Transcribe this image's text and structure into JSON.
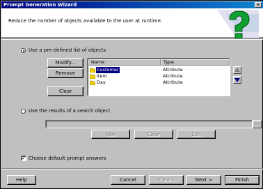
{
  "window": {
    "title": "Prompt Generation Wizard",
    "close_glyph": "×"
  },
  "header": {
    "description": "Reduce the number of objects available to the user at runtime."
  },
  "options": {
    "predefined_label": "Use a pre-defined list of objects",
    "predefined_selected": true,
    "search_label": "Use the results of a search object",
    "search_selected": false
  },
  "list_buttons": {
    "modify": "Modify...",
    "remove": "Remove",
    "clear": "Clear"
  },
  "list": {
    "columns": [
      "Name",
      "Type"
    ],
    "rows": [
      {
        "name": "Customer",
        "type": "Attribute",
        "selected": true
      },
      {
        "name": "Item",
        "type": "Attribute",
        "selected": false
      },
      {
        "name": "Day",
        "type": "Attribute",
        "selected": false
      }
    ]
  },
  "search": {
    "value": "",
    "ellipsis": "...",
    "buttons": {
      "new": "New",
      "clear": "Clear",
      "edit": "Edit"
    }
  },
  "default_answers": {
    "label": "Choose default prompt answers",
    "checked": true,
    "check_glyph": "✓"
  },
  "footer": {
    "help": "Help",
    "cancel": "Cancel",
    "back": "< Back",
    "next": "Next >",
    "finish": "Finish"
  },
  "colors": {
    "titlebar_start": "#000080",
    "titlebar_end": "#1084d0",
    "selection": "#000080",
    "folder": "#f0d000"
  },
  "icons": {
    "header_art": "green-question-mark-icon",
    "up": "arrow-up-icon",
    "down": "arrow-down-icon",
    "folder": "folder-icon"
  }
}
